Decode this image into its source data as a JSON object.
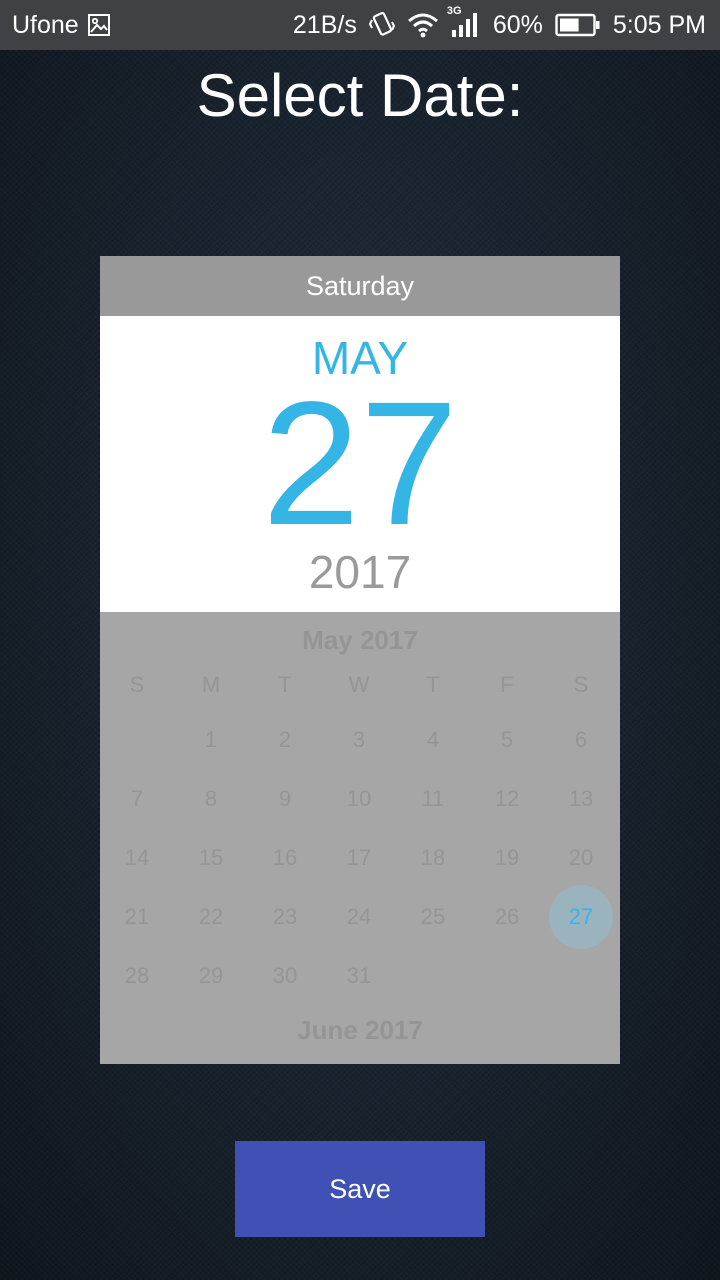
{
  "status_bar": {
    "carrier": "Ufone",
    "net_speed": "21B/s",
    "network_type": "3G",
    "battery": "60%",
    "time": "5:05 PM",
    "icons": [
      "image-notification-icon",
      "vibrate-icon",
      "wifi-icon",
      "signal-icon",
      "battery-icon"
    ],
    "battery_level": 0.6
  },
  "page": {
    "title": "Select Date:"
  },
  "date_picker": {
    "weekday": "Saturday",
    "month": "MAY",
    "day": "27",
    "year": "2017",
    "calendar": {
      "month_title": "May 2017",
      "weekday_headers": [
        "S",
        "M",
        "T",
        "W",
        "T",
        "F",
        "S"
      ],
      "first_weekday_index": 1,
      "days_in_month": 31,
      "selected_day": 27,
      "next_month_title": "June 2017"
    }
  },
  "actions": {
    "save_label": "Save"
  },
  "colors": {
    "accent": "#34b5e5",
    "button": "#3f51b5",
    "header": "#999999",
    "calendar_bg": "#a6a6a6"
  }
}
